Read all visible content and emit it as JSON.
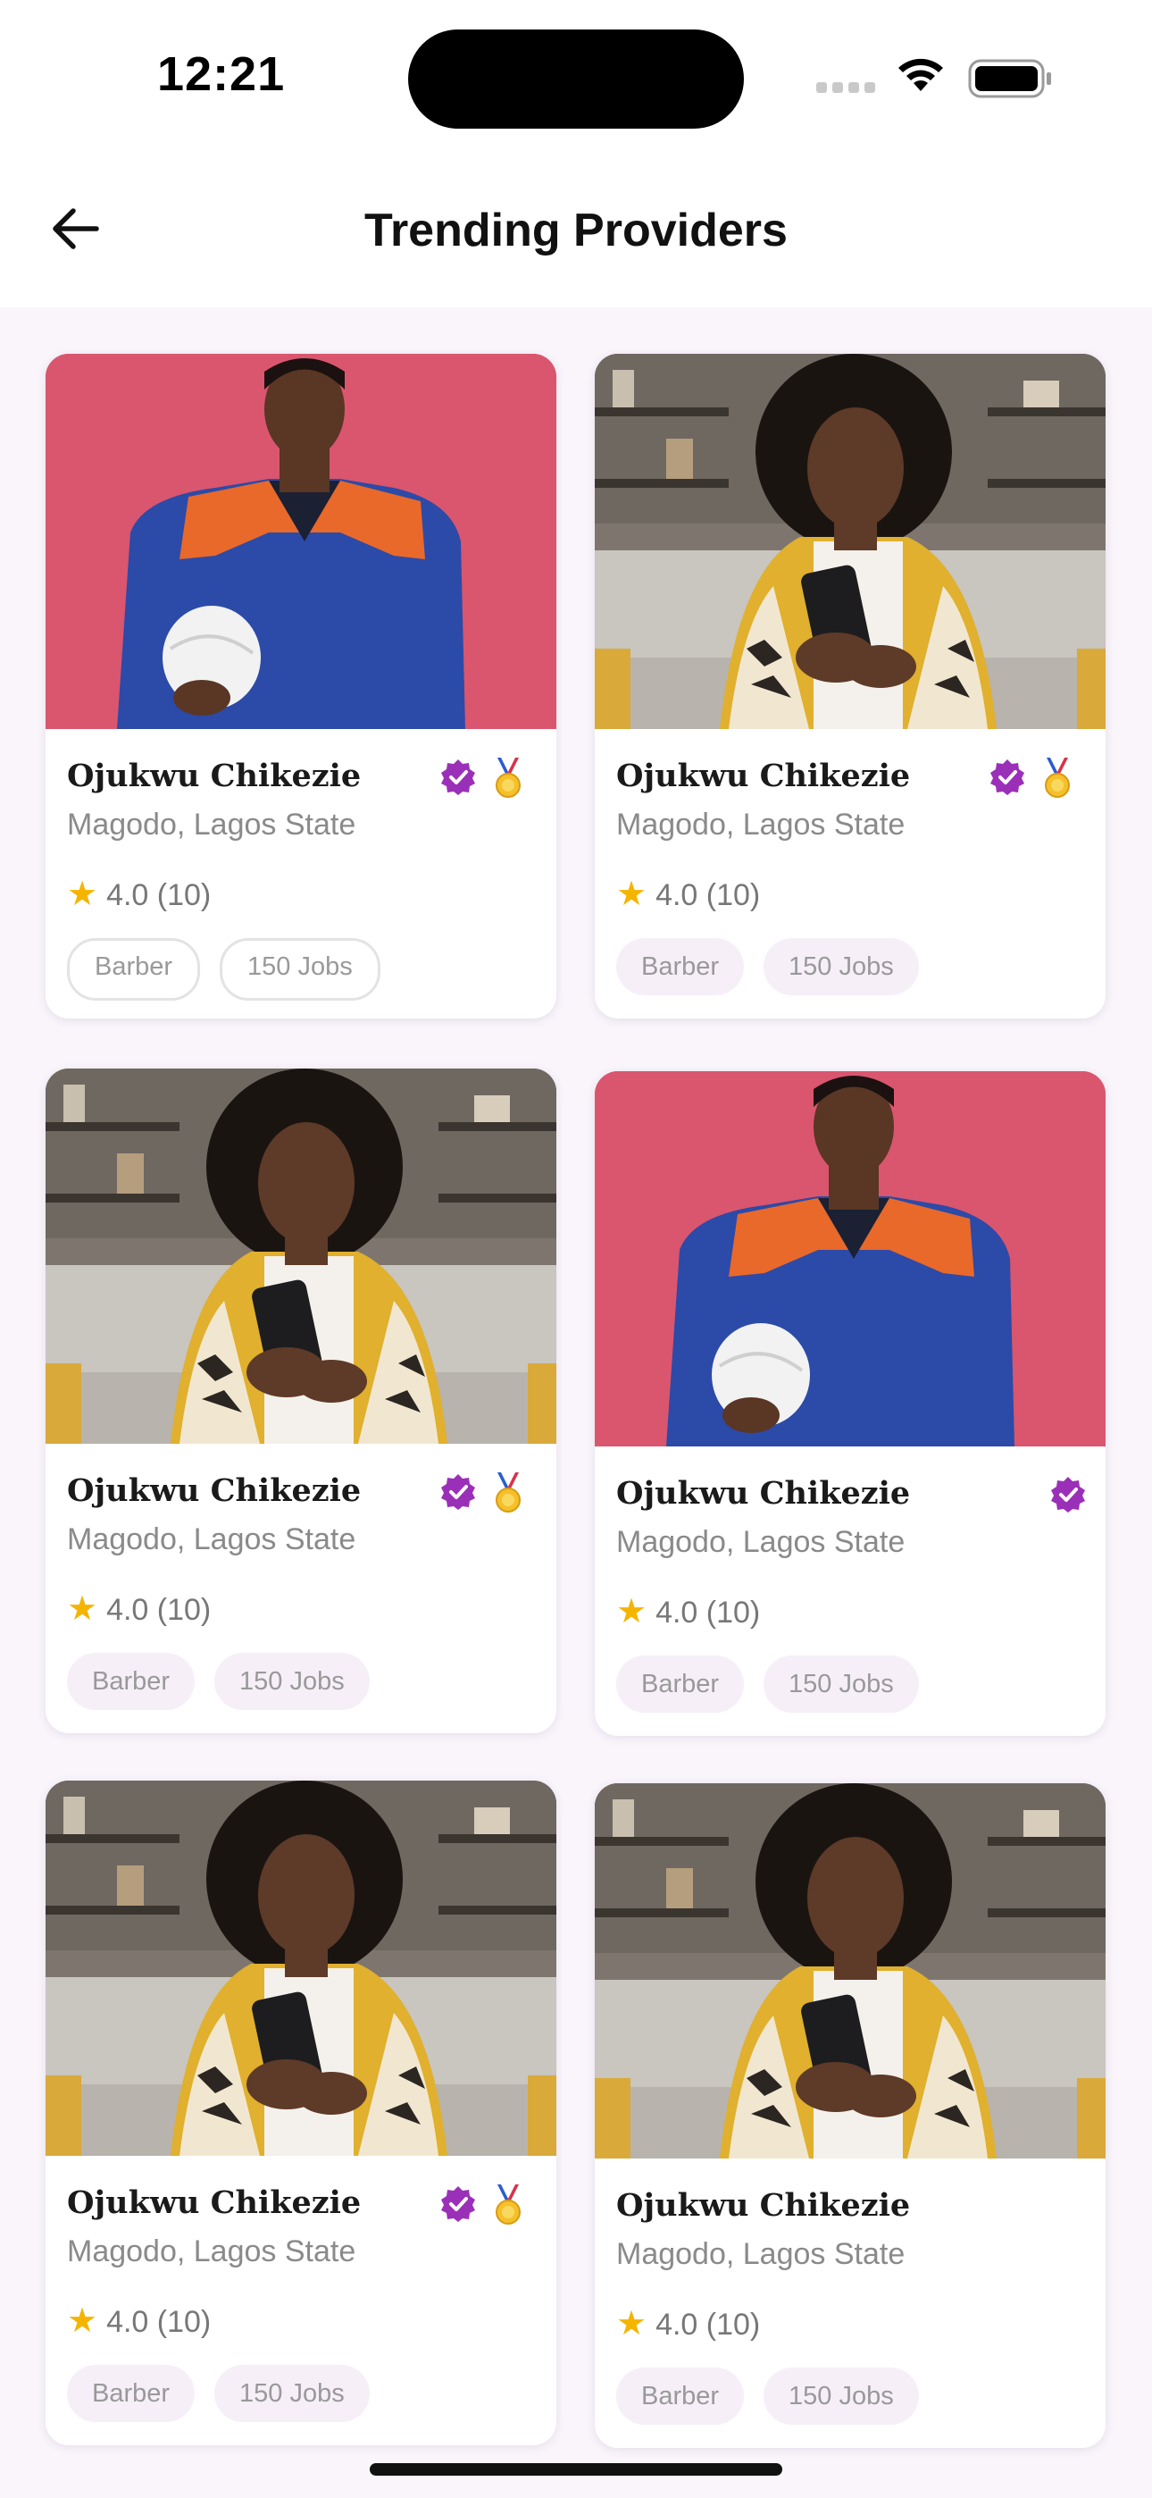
{
  "status_bar": {
    "time": "12:21"
  },
  "header": {
    "title": "Trending Providers"
  },
  "colors": {
    "verified": "#9b30b8",
    "star": "#f5b400",
    "chip_bg": "#f6eff8"
  },
  "providers": [
    {
      "name": "Ojukwu Chikezie",
      "location": "Magodo, Lagos State",
      "rating": "4.0 (10)",
      "tags": [
        "Barber",
        "150 Jobs"
      ],
      "photo": "man-in-workwear-holding-helmet",
      "verified": true,
      "medal": true
    },
    {
      "name": "Ojukwu Chikezie",
      "location": "Magodo, Lagos State",
      "rating": "4.0 (10)",
      "tags": [
        "Barber",
        "150 Jobs"
      ],
      "photo": "woman-using-phone-on-sofa",
      "verified": true,
      "medal": true
    },
    {
      "name": "Ojukwu Chikezie",
      "location": "Magodo, Lagos State",
      "rating": "4.0 (10)",
      "tags": [
        "Barber",
        "150 Jobs"
      ],
      "photo": "woman-using-phone-on-sofa",
      "verified": true,
      "medal": true
    },
    {
      "name": "Ojukwu Chikezie",
      "location": "Magodo, Lagos State",
      "rating": "4.0 (10)",
      "tags": [
        "Barber",
        "150 Jobs"
      ],
      "photo": "man-in-workwear-holding-helmet",
      "verified": true,
      "medal": false
    },
    {
      "name": "Ojukwu Chikezie",
      "location": "Magodo, Lagos State",
      "rating": "4.0 (10)",
      "tags": [
        "Barber",
        "150 Jobs"
      ],
      "photo": "woman-using-phone-on-sofa",
      "verified": true,
      "medal": true
    },
    {
      "name": "Ojukwu Chikezie",
      "location": "Magodo, Lagos State",
      "rating": "4.0 (10)",
      "tags": [
        "Barber",
        "150 Jobs"
      ],
      "photo": "woman-using-phone-on-sofa",
      "verified": false,
      "medal": false
    }
  ]
}
